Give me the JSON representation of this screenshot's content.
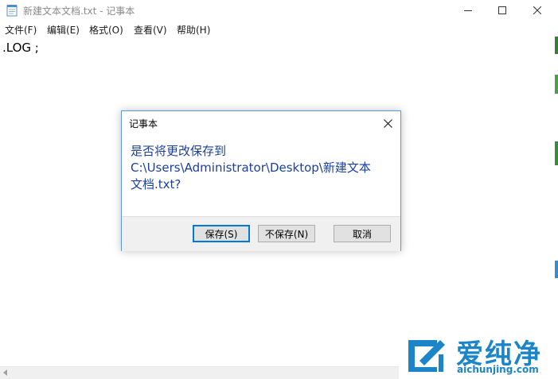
{
  "window": {
    "title": "新建文本文档.txt - 记事本"
  },
  "menu": {
    "items": [
      "文件(F)",
      "编辑(E)",
      "格式(O)",
      "查看(V)",
      "帮助(H)"
    ]
  },
  "editor": {
    "content": ".LOG ;"
  },
  "dialog": {
    "title": "记事本",
    "message_line1": "是否将更改保存到",
    "message_line2": "C:\\Users\\Administrator\\Desktop\\新建文本",
    "message_line3": "文档.txt?",
    "buttons": {
      "save": "保存(S)",
      "dont_save": "不保存(N)",
      "cancel": "取消"
    }
  },
  "watermark": {
    "title": "爱纯净",
    "url": "aichunjing.com"
  },
  "colors": {
    "accent": "#0078d7",
    "dialog_text": "#1a3f9f",
    "watermark": "#1b85c8"
  }
}
